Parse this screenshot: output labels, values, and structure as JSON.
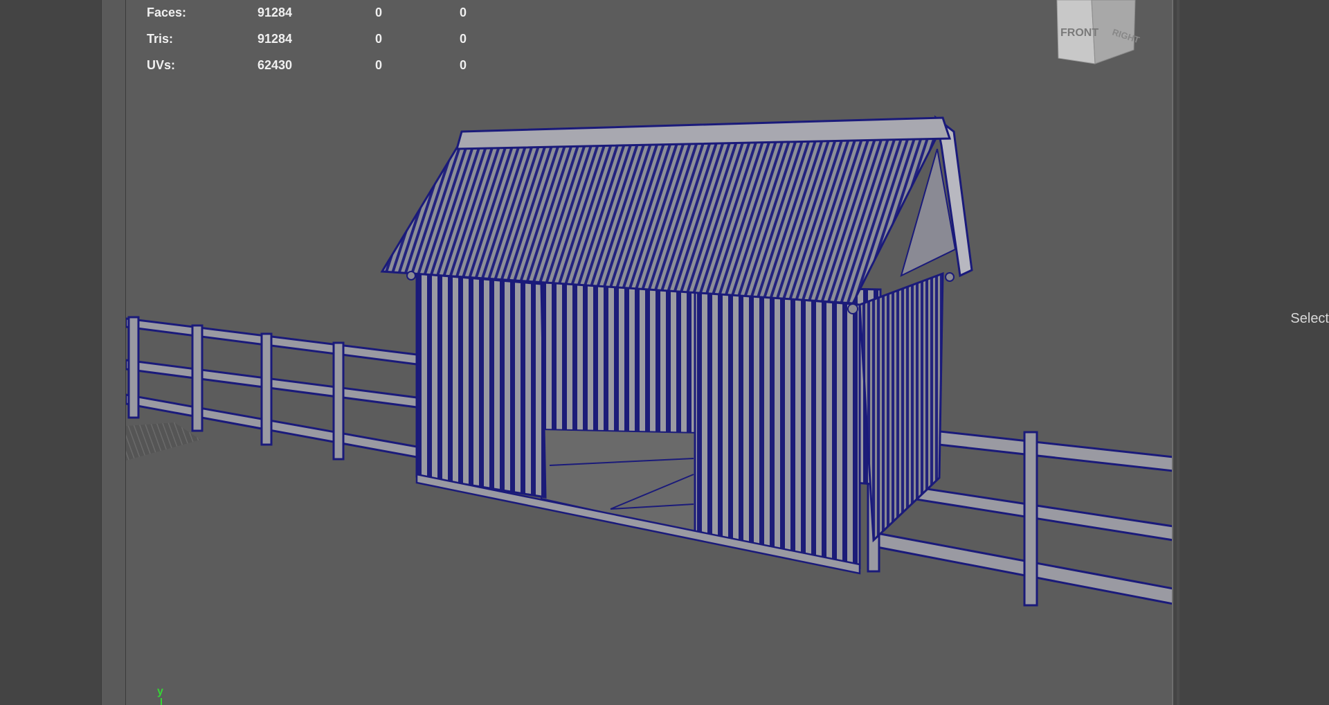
{
  "hud": {
    "rows": [
      {
        "label": "Faces:",
        "v1": "91284",
        "v2": "0",
        "v3": "0"
      },
      {
        "label": "Tris:",
        "v1": "91284",
        "v2": "0",
        "v3": "0"
      },
      {
        "label": "UVs:",
        "v1": "62430",
        "v2": "0",
        "v3": "0"
      }
    ]
  },
  "viewcube": {
    "front_label": "FRONT",
    "right_label": "RIGHT"
  },
  "side_panel": {
    "select_label": "Select"
  },
  "axis": {
    "y_label": "y"
  },
  "colors": {
    "viewport_bg": "#5c5c5c",
    "wireframe": "#1a1a7a",
    "mesh_fill": "#8e8e96",
    "axis_y": "#35d635"
  }
}
